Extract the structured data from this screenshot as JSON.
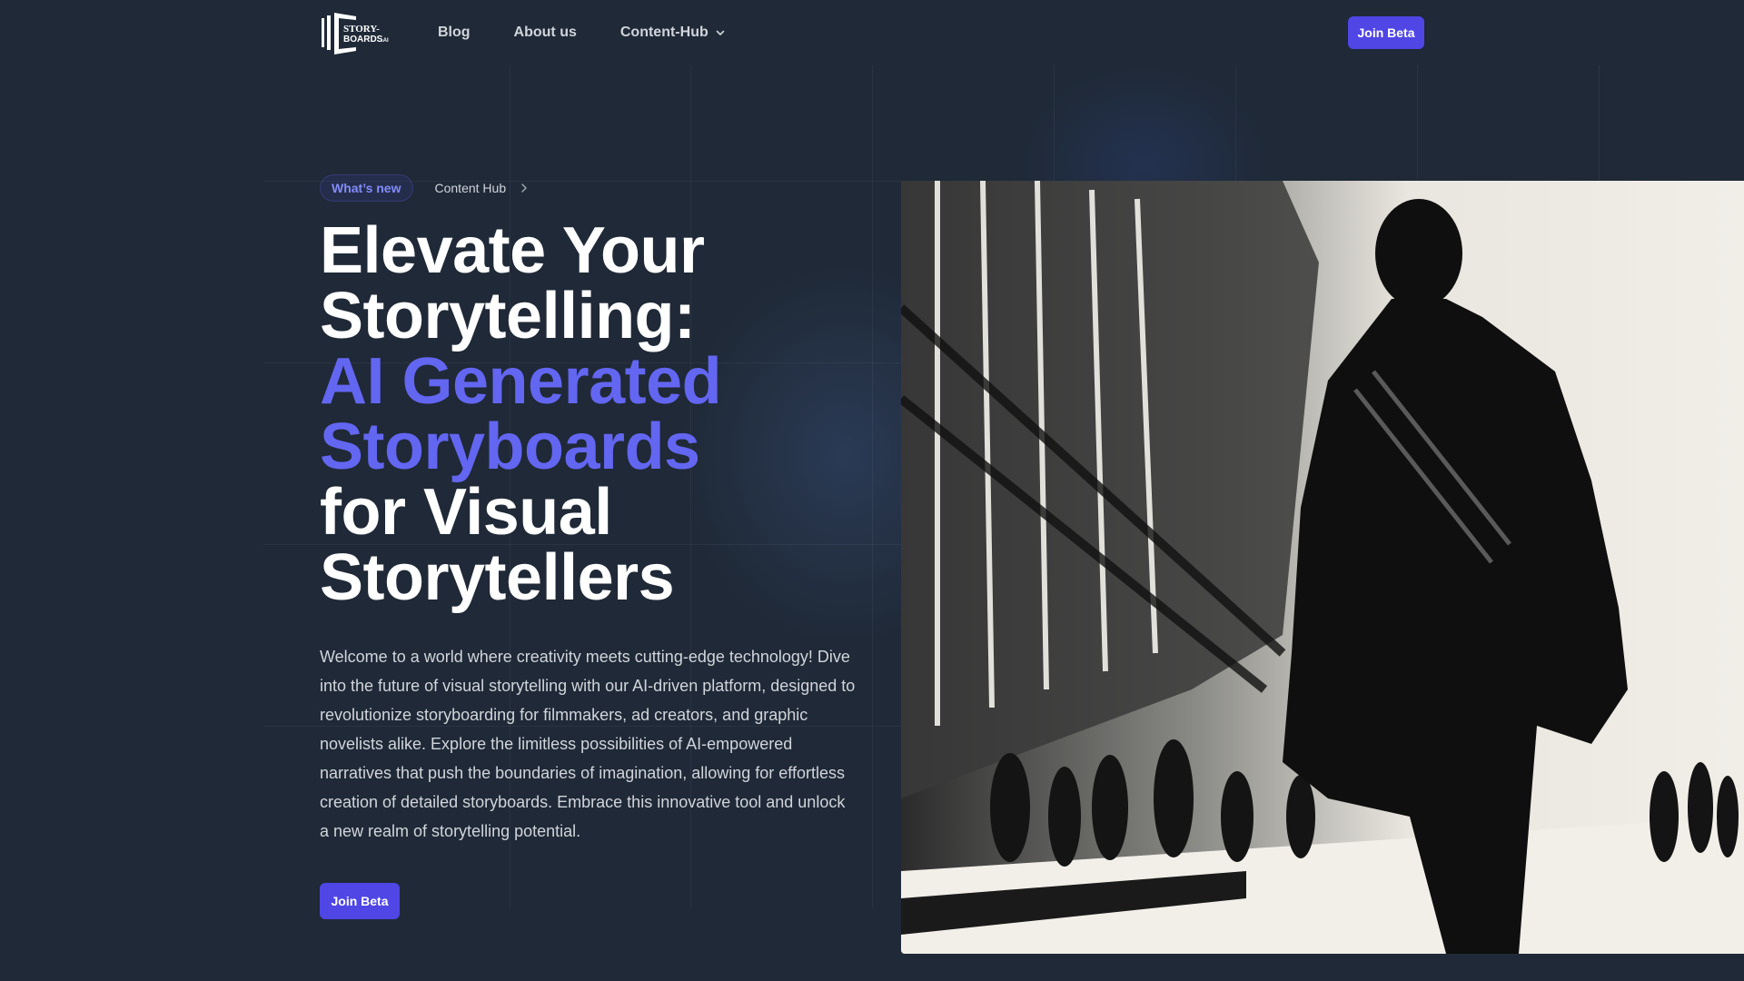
{
  "brand": {
    "logo_line1": "STORY-",
    "logo_line2": "BOARDS",
    "logo_suffix": ".AI"
  },
  "nav": {
    "items": [
      {
        "label": "Blog"
      },
      {
        "label": "About us"
      },
      {
        "label": "Content-Hub",
        "has_dropdown": true
      }
    ],
    "cta_label": "Join Beta"
  },
  "hero": {
    "badge": "What’s new",
    "breadcrumb": "Content Hub",
    "headline": {
      "line1": "Elevate Your",
      "line2": "Storytelling:",
      "accent_line1": "AI Generated",
      "accent_line2": "Storyboards",
      "line3": "for Visual",
      "line4": "Storytellers"
    },
    "description": "Welcome to a world where creativity meets cutting-edge technology! Dive into the future of visual storytelling with our AI-driven platform, designed to revolutionize storyboarding for filmmakers, ad creators, and graphic novelists alike. Explore the limitless possibilities of AI-empowered narratives that push the boundaries of imagination, allowing for effortless creation of detailed storyboards. Embrace this innovative tool and unlock a new realm of storytelling potential.",
    "cta_label": "Join Beta",
    "image_alt": "Black and white ink illustration of a man in a long coat walking down a crowded city street"
  },
  "colors": {
    "background": "#1f2937",
    "accent": "#6366f1",
    "button": "#4f46e5",
    "text_muted": "#d1d5db"
  }
}
